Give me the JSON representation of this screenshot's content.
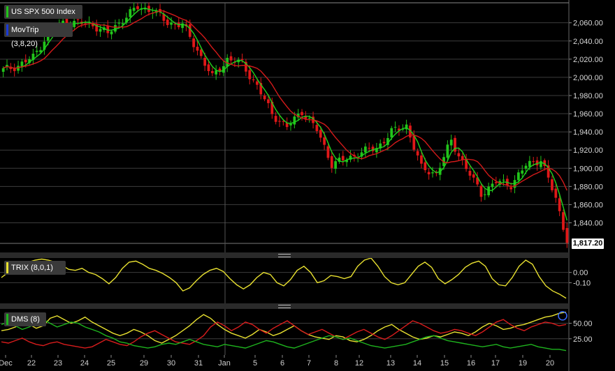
{
  "chart_data": [
    {
      "type": "candlestick",
      "title": "US SPX 500 Index",
      "overlay": "MovTrip (3,8,20)",
      "last_price": "1,817.20",
      "y_ticks": [
        "2,060.00",
        "2,040.00",
        "2,020.00",
        "2,000.00",
        "1,980.00",
        "1,960.00",
        "1,940.00",
        "1,920.00",
        "1,900.00",
        "1,880.00",
        "1,860.00",
        "1,840.00"
      ],
      "ylim": [
        1812,
        2082
      ],
      "x_ticks": [
        "Dec",
        "22",
        "23",
        "24",
        "25",
        "29",
        "30",
        "31",
        "Jan",
        "5",
        "6",
        "7",
        "8",
        "12",
        "13",
        "14",
        "15",
        "16",
        "17",
        "19",
        "20"
      ],
      "key_points": [
        [
          0,
          2008
        ],
        [
          4,
          2013
        ],
        [
          8,
          2022
        ],
        [
          12,
          2048
        ],
        [
          16,
          2060
        ],
        [
          20,
          2060
        ],
        [
          24,
          2058
        ],
        [
          28,
          2048
        ],
        [
          32,
          2064
        ],
        [
          36,
          2077
        ],
        [
          40,
          2074
        ],
        [
          44,
          2060
        ],
        [
          48,
          2058
        ],
        [
          52,
          2030
        ],
        [
          56,
          2000
        ],
        [
          60,
          2020
        ],
        [
          64,
          2015
        ],
        [
          68,
          1990
        ],
        [
          72,
          1960
        ],
        [
          76,
          1945
        ],
        [
          80,
          1963
        ],
        [
          84,
          1942
        ],
        [
          88,
          1905
        ],
        [
          92,
          1910
        ],
        [
          96,
          1918
        ],
        [
          100,
          1922
        ],
        [
          104,
          1940
        ],
        [
          108,
          1947
        ],
        [
          112,
          1900
        ],
        [
          116,
          1894
        ],
        [
          120,
          1930
        ],
        [
          124,
          1900
        ],
        [
          128,
          1872
        ],
        [
          132,
          1885
        ],
        [
          136,
          1882
        ],
        [
          140,
          1903
        ],
        [
          144,
          1910
        ],
        [
          148,
          1866
        ],
        [
          150,
          1836
        ],
        [
          151,
          1818
        ]
      ],
      "colors": {
        "up": "#22c41a",
        "down": "#e01818",
        "ma_fast": "#1ed21e",
        "ma_slow": "#d41a1a",
        "grid": "#444444",
        "background": "#000000"
      }
    },
    {
      "type": "line",
      "title": "TRIX (8,0,1)",
      "y_ticks": [
        "0.00",
        "-0.10"
      ],
      "ylim": [
        -0.28,
        0.14
      ],
      "series": [
        {
          "color": "#e8e030",
          "values": [
            -0.05,
            0.0,
            0.05,
            0.08,
            0.1,
            0.12,
            0.13,
            0.12,
            0.1,
            0.07,
            0.03,
            0.02,
            0.04,
            0.0,
            -0.02,
            -0.06,
            -0.11,
            -0.05,
            0.04,
            0.1,
            0.11,
            0.08,
            0.04,
            0.02,
            -0.01,
            -0.05,
            -0.1,
            -0.18,
            -0.15,
            -0.08,
            -0.02,
            0.02,
            0.04,
            0.01,
            -0.06,
            -0.12,
            -0.16,
            -0.12,
            -0.05,
            0.0,
            -0.02,
            -0.1,
            -0.13,
            -0.07,
            0.02,
            0.06,
            0.0,
            -0.1,
            -0.08,
            -0.03,
            -0.04,
            -0.06,
            -0.04,
            0.06,
            0.12,
            0.14,
            0.06,
            -0.04,
            -0.1,
            -0.12,
            -0.1,
            -0.02,
            0.06,
            0.1,
            0.05,
            -0.06,
            -0.11,
            -0.07,
            -0.02,
            0.05,
            0.09,
            0.11,
            0.06,
            -0.06,
            -0.12,
            -0.13,
            -0.05,
            0.06,
            0.12,
            0.08,
            -0.04,
            -0.13,
            -0.18,
            -0.21,
            -0.25
          ]
        }
      ]
    },
    {
      "type": "line",
      "title": "DMS (8)",
      "y_ticks": [
        "50.00",
        "25.00"
      ],
      "ylim": [
        0,
        72
      ],
      "series": [
        {
          "color": "#e8e030",
          "values": [
            38,
            40,
            44,
            50,
            48,
            42,
            46,
            58,
            62,
            56,
            50,
            54,
            60,
            52,
            46,
            40,
            34,
            30,
            34,
            40,
            36,
            30,
            22,
            18,
            24,
            30,
            38,
            46,
            56,
            64,
            58,
            48,
            40,
            34,
            30,
            26,
            32,
            40,
            36,
            30,
            34,
            40,
            46,
            38,
            32,
            28,
            26,
            24,
            30,
            28,
            22,
            20,
            24,
            30,
            38,
            44,
            48,
            40,
            34,
            28,
            24,
            26,
            30,
            28,
            32,
            36,
            34,
            30,
            36,
            44,
            50,
            46,
            40,
            42,
            46,
            48,
            52,
            56,
            60,
            62,
            66,
            68
          ]
        },
        {
          "color": "#d81c1c",
          "values": [
            20,
            18,
            22,
            26,
            20,
            16,
            14,
            18,
            20,
            16,
            14,
            12,
            10,
            12,
            18,
            24,
            20,
            16,
            14,
            20,
            28,
            34,
            38,
            32,
            26,
            20,
            18,
            16,
            22,
            30,
            44,
            52,
            46,
            38,
            44,
            52,
            48,
            40,
            34,
            42,
            48,
            54,
            46,
            38,
            32,
            36,
            40,
            34,
            28,
            24,
            30,
            36,
            40,
            34,
            28,
            24,
            30,
            38,
            46,
            54,
            50,
            44,
            38,
            34,
            36,
            40,
            38,
            34,
            30,
            36,
            44,
            52,
            56,
            48,
            42,
            38,
            44,
            48,
            52,
            50,
            46,
            48
          ]
        },
        {
          "color": "#1eb41e",
          "values": [
            48,
            52,
            46,
            40,
            44,
            50,
            56,
            50,
            44,
            48,
            52,
            50,
            44,
            40,
            36,
            30,
            26,
            20,
            18,
            14,
            12,
            10,
            12,
            16,
            18,
            16,
            20,
            24,
            20,
            16,
            14,
            12,
            16,
            14,
            12,
            10,
            14,
            18,
            22,
            20,
            16,
            12,
            10,
            14,
            18,
            22,
            26,
            30,
            28,
            24,
            26,
            22,
            18,
            14,
            12,
            10,
            12,
            14,
            16,
            20,
            24,
            28,
            30,
            26,
            22,
            20,
            18,
            16,
            14,
            12,
            14,
            16,
            12,
            10,
            12,
            14,
            16,
            12,
            10,
            8,
            8,
            6
          ]
        }
      ]
    }
  ],
  "chart_colors": {
    "text": "#d8d8d8",
    "price_tag_bg": "#ffffff",
    "panel_sep": "#2a2a2a"
  }
}
